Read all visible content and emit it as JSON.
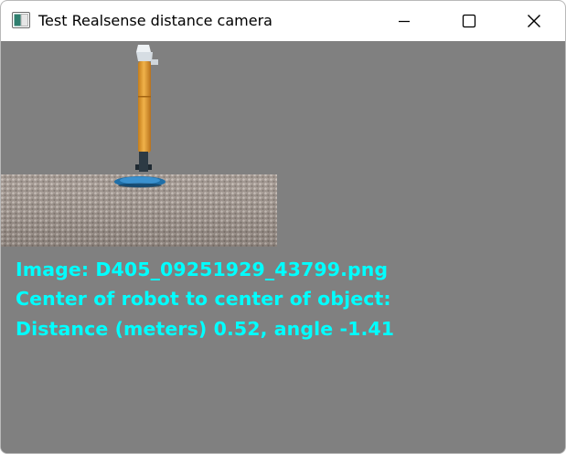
{
  "window": {
    "title": "Test Realsense distance camera",
    "icon": "app-window-icon",
    "controls": {
      "minimize": "minimize-icon",
      "maximize": "maximize-icon",
      "close": "close-icon"
    }
  },
  "camera": {
    "image_name": "camera-frame-image"
  },
  "overlay": {
    "line1": "Image: D405_09251929_43799.png",
    "line2": "Center of robot to center of object:",
    "line3": "Distance (meters) 0.52, angle -1.41",
    "text_color": "#00ffff"
  },
  "colors": {
    "background": "#808080",
    "titlebar": "#ffffff"
  }
}
